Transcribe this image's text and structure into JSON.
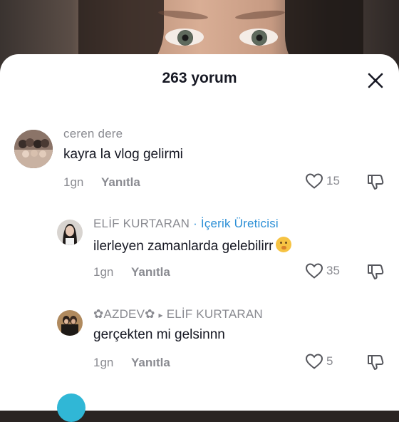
{
  "header": {
    "title": "263 yorum"
  },
  "comments": [
    {
      "username": "ceren dere",
      "text": "kayra la vlog gelirmi",
      "time": "1gn",
      "reply_label": "Yanıtla",
      "likes": "15"
    },
    {
      "username": "ELİF KURTARAN",
      "separator": " · ",
      "creator_label": "İçerik Üreticisi",
      "text": "ilerleyen zamanlarda gelebilirr",
      "emoji": "shushing-face-emoji",
      "time": "1gn",
      "reply_label": "Yanıtla",
      "likes": "35"
    },
    {
      "username": "✿AZDEV✿",
      "arrow": "▸",
      "reply_to": "ELİF KURTARAN",
      "text": "gerçekten mi gelsinnn",
      "time": "1gn",
      "reply_label": "Yanıtla",
      "likes": "5"
    }
  ],
  "colors": {
    "creator": "#2b8fd6",
    "meta": "#8a8b91",
    "text": "#161823"
  },
  "icons": [
    "close-icon",
    "heart-icon",
    "dislike-icon"
  ]
}
